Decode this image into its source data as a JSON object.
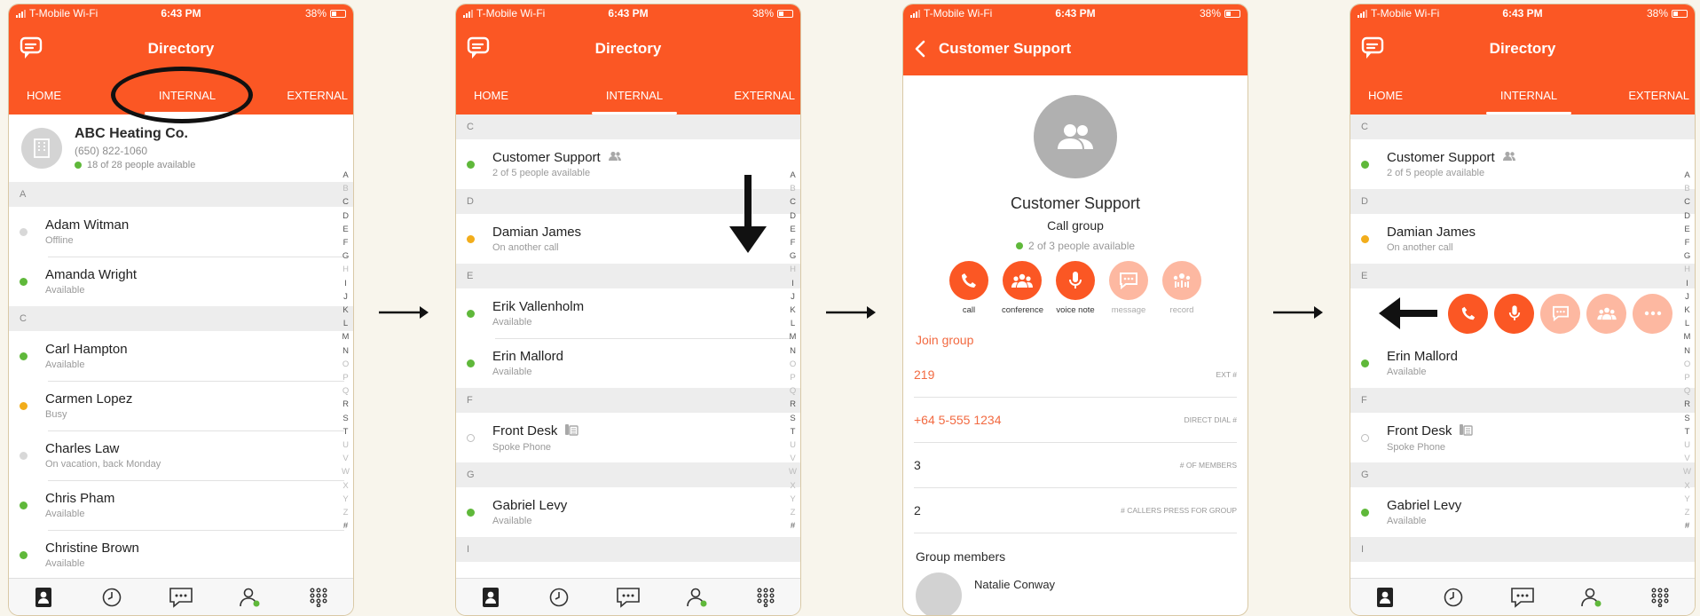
{
  "status": {
    "carrier": "T-Mobile Wi-Fi",
    "time": "6:43 PM",
    "battery": "38%"
  },
  "directory": {
    "title": "Directory",
    "tabs": [
      "HOME",
      "INTERNAL",
      "EXTERNAL"
    ]
  },
  "screen1": {
    "company": {
      "name": "ABC Heating Co.",
      "phone": "(650) 822-1060",
      "availability": "18 of 28 people available"
    },
    "sections": [
      {
        "letter": "A",
        "rows": [
          {
            "name": "Adam Witman",
            "status": "Offline",
            "dot": "gray"
          },
          {
            "name": "Amanda Wright",
            "status": "Available",
            "dot": "green"
          }
        ]
      },
      {
        "letter": "C",
        "rows": [
          {
            "name": "Carl Hampton",
            "status": "Available",
            "dot": "green"
          },
          {
            "name": "Carmen Lopez",
            "status": "Busy",
            "dot": "yellow"
          },
          {
            "name": "Charles Law",
            "status": "On vacation, back Monday",
            "dot": "gray"
          },
          {
            "name": "Chris Pham",
            "status": "Available",
            "dot": "green"
          },
          {
            "name": "Christine Brown",
            "status": "Available",
            "dot": "green"
          }
        ]
      }
    ]
  },
  "list": {
    "sections": [
      {
        "letter": "C",
        "rows": [
          {
            "name": "Customer Support",
            "status": "2 of 5 people available",
            "dot": "green",
            "icon": "group"
          }
        ]
      },
      {
        "letter": "D",
        "rows": [
          {
            "name": "Damian James",
            "status": "On another call",
            "dot": "yellow"
          }
        ]
      },
      {
        "letter": "E",
        "rows": [
          {
            "name": "Erik Vallenholm",
            "status": "Available",
            "dot": "green"
          },
          {
            "name": "Erin Mallord",
            "status": "Available",
            "dot": "green"
          }
        ]
      },
      {
        "letter": "F",
        "rows": [
          {
            "name": "Front Desk",
            "status": "Spoke Phone",
            "dot": "hollow",
            "icon": "desk"
          }
        ]
      },
      {
        "letter": "G",
        "rows": [
          {
            "name": "Gabriel Levy",
            "status": "Available",
            "dot": "green"
          }
        ]
      },
      {
        "letter": "I",
        "rows": []
      }
    ]
  },
  "alphabet": [
    "A",
    "B",
    "C",
    "D",
    "E",
    "F",
    "G",
    "H",
    "I",
    "J",
    "K",
    "L",
    "M",
    "N",
    "O",
    "P",
    "Q",
    "R",
    "S",
    "T",
    "U",
    "V",
    "W",
    "X",
    "Y",
    "Z",
    "#"
  ],
  "detail": {
    "back_title": "Customer Support",
    "name": "Customer Support",
    "type": "Call group",
    "availability": "2 of 3 people available",
    "actions": [
      {
        "label": "call",
        "icon": "phone-icon",
        "enabled": true
      },
      {
        "label": "conference",
        "icon": "conference-icon",
        "enabled": true
      },
      {
        "label": "voice note",
        "icon": "microphone-icon",
        "enabled": true
      },
      {
        "label": "message",
        "icon": "message-icon",
        "enabled": false
      },
      {
        "label": "record",
        "icon": "record-icon",
        "enabled": false
      }
    ],
    "join": "Join group",
    "fields": [
      {
        "value": "219",
        "key": "EXT #",
        "orange": true
      },
      {
        "value": "+64 5-555 1234",
        "key": "DIRECT DIAL #",
        "orange": true
      },
      {
        "value": "3",
        "key": "# OF MEMBERS",
        "orange": false
      },
      {
        "value": "2",
        "key": "# CALLERS PRESS FOR GROUP",
        "orange": false
      }
    ],
    "members_title": "Group members",
    "member_name": "Natalie Conway"
  },
  "colors": {
    "brand": "#fb5724",
    "available": "#5fb83a",
    "busy": "#f2ad1b"
  }
}
